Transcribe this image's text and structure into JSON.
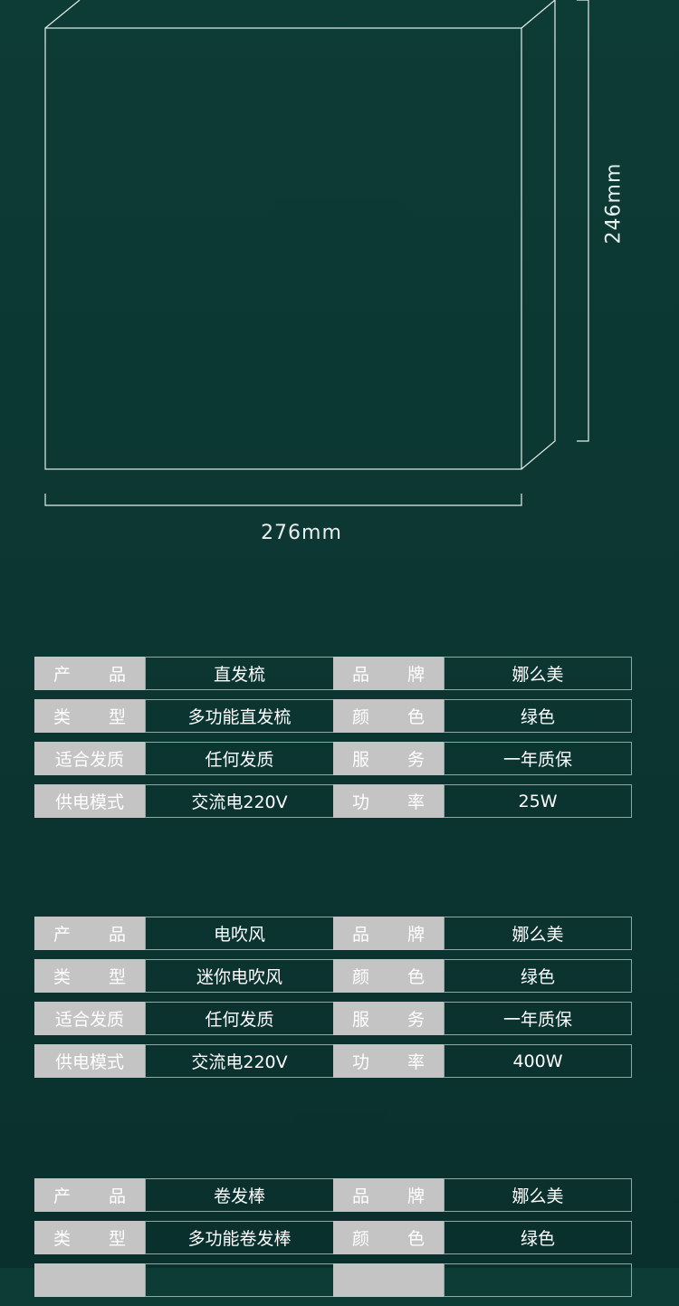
{
  "dimensions": {
    "width": "276mm",
    "height": "246mm"
  },
  "tables": [
    {
      "rows": [
        {
          "label1": "产 品",
          "value1": "直发梳",
          "label2": "品 牌",
          "value2": "娜么美"
        },
        {
          "label1": "类 型",
          "value1": "多功能直发梳",
          "label2": "颜 色",
          "value2": "绿色"
        },
        {
          "label1": "适合发质",
          "value1": "任何发质",
          "label2": "服 务",
          "value2": "一年质保"
        },
        {
          "label1": "供电模式",
          "value1": "交流电220V",
          "label2": "功 率",
          "value2": "25W"
        }
      ]
    },
    {
      "rows": [
        {
          "label1": "产 品",
          "value1": "电吹风",
          "label2": "品 牌",
          "value2": "娜么美"
        },
        {
          "label1": "类 型",
          "value1": "迷你电吹风",
          "label2": "颜 色",
          "value2": "绿色"
        },
        {
          "label1": "适合发质",
          "value1": "任何发质",
          "label2": "服 务",
          "value2": "一年质保"
        },
        {
          "label1": "供电模式",
          "value1": "交流电220V",
          "label2": "功 率",
          "value2": "400W"
        }
      ]
    },
    {
      "rows": [
        {
          "label1": "产 品",
          "value1": "卷发棒",
          "label2": "品 牌",
          "value2": "娜么美"
        },
        {
          "label1": "类 型",
          "value1": "多功能卷发棒",
          "label2": "颜 色",
          "value2": "绿色"
        },
        {
          "label1": "",
          "value1": "",
          "label2": "",
          "value2": ""
        }
      ]
    }
  ]
}
